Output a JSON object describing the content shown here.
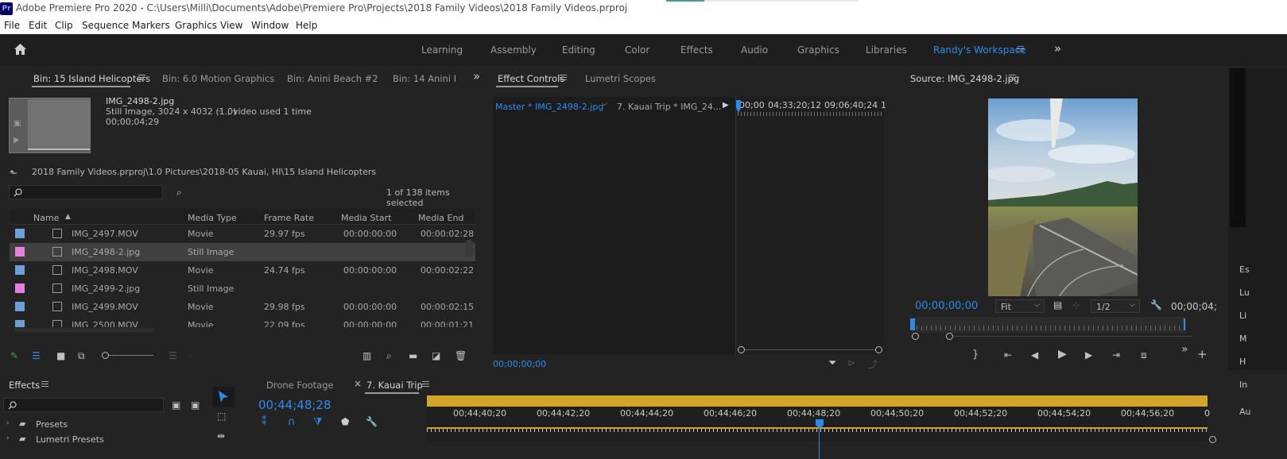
{
  "window": {
    "title": "Adobe Premiere Pro 2020 - C:\\Users\\Milli\\Documents\\Adobe\\Premiere Pro\\Projects\\2018 Family Videos\\2018 Family Videos.prproj",
    "app_badge": "Pr"
  },
  "menu": [
    "File",
    "Edit",
    "Clip",
    "Sequence",
    "Markers",
    "Graphics",
    "View",
    "Window",
    "Help"
  ],
  "workspaces": [
    "Learning",
    "Assembly",
    "Editing",
    "Color",
    "Effects",
    "Audio",
    "Graphics",
    "Libraries",
    "Randy's Workspace"
  ],
  "project": {
    "tabs": [
      "Bin: 15 Island Helicopters",
      "Bin: 6.0 Motion Graphics",
      "Bin: Anini Beach #2",
      "Bin: 14 Anini Bea"
    ],
    "preview": {
      "filename": "IMG_2498-2.jpg",
      "info_line": "Still Image, 3024 x 4032 (1.0)",
      "usage": ", video used 1 time",
      "duration": "00;00;04;29"
    },
    "path": "2018 Family Videos.prproj\\1.0 Pictures\\2018-05 Kauai, HI\\15 Island Helicopters",
    "selection_count": "1 of 138 items selected",
    "columns": [
      "Name",
      "Media Type",
      "Frame Rate",
      "Media Start",
      "Media End"
    ],
    "rows": [
      {
        "name": "IMG_2497.MOV",
        "type": "Movie",
        "fps": "29.97 fps",
        "start": "00:00:00:00",
        "end": "00:00:02:28",
        "color": "#6d9fd8",
        "selected": false
      },
      {
        "name": "IMG_2498-2.jpg",
        "type": "Still Image",
        "fps": "",
        "start": "",
        "end": "",
        "color": "#e77fdd",
        "selected": true
      },
      {
        "name": "IMG_2498.MOV",
        "type": "Movie",
        "fps": "24.74 fps",
        "start": "00:00:00:00",
        "end": "00:00:02:22",
        "color": "#6d9fd8",
        "selected": false
      },
      {
        "name": "IMG_2499-2.jpg",
        "type": "Still Image",
        "fps": "",
        "start": "",
        "end": "",
        "color": "#e77fdd",
        "selected": false
      },
      {
        "name": "IMG_2499.MOV",
        "type": "Movie",
        "fps": "29.98 fps",
        "start": "00:00:00:00",
        "end": "00:00:02:15",
        "color": "#6d9fd8",
        "selected": false
      },
      {
        "name": "IMG_2500.MOV",
        "type": "Movie",
        "fps": "22.09 fps",
        "start": "00:00:00:00",
        "end": "00:00:01:21",
        "color": "#6d9fd8",
        "selected": false
      }
    ]
  },
  "effect_controls": {
    "tabs": [
      "Effect Controls",
      "Lumetri Scopes"
    ],
    "master": "Master * IMG_2498-2.jpg",
    "sequence": "7. Kauai Trip * IMG_24...",
    "ruler": [
      "00;00",
      "04;33;20;12",
      "09;06;40;24",
      "1"
    ],
    "timecode": "00;00;00;00"
  },
  "source": {
    "title": "Source: IMG_2498-2.jpg",
    "timecode": "00;00;00;00",
    "fit": "Fit",
    "resolution": "1/2",
    "duration": "00;00;04;"
  },
  "effects_panel": {
    "title": "Effects",
    "items": [
      "Presets",
      "Lumetri Presets"
    ]
  },
  "timeline": {
    "tabs": [
      "Drone Footage",
      "7. Kauai Trip"
    ],
    "close_glyph": "×",
    "timecode": "00;44;48;28",
    "ruler": [
      "00;44;40;20",
      "00;44;42;20",
      "00;44;44;20",
      "00;44;46;20",
      "00;44;48;20",
      "00;44;50;20",
      "00;44;52;20",
      "00;44;54;20",
      "00;44;56;20",
      "0"
    ]
  },
  "right_edge": [
    "Es",
    "Lu",
    "Li",
    "M",
    "H",
    "In",
    "Au"
  ],
  "colors": {
    "accent": "#2d8ceb",
    "workarea": "#d4a42a",
    "selected_row": "#404040"
  }
}
